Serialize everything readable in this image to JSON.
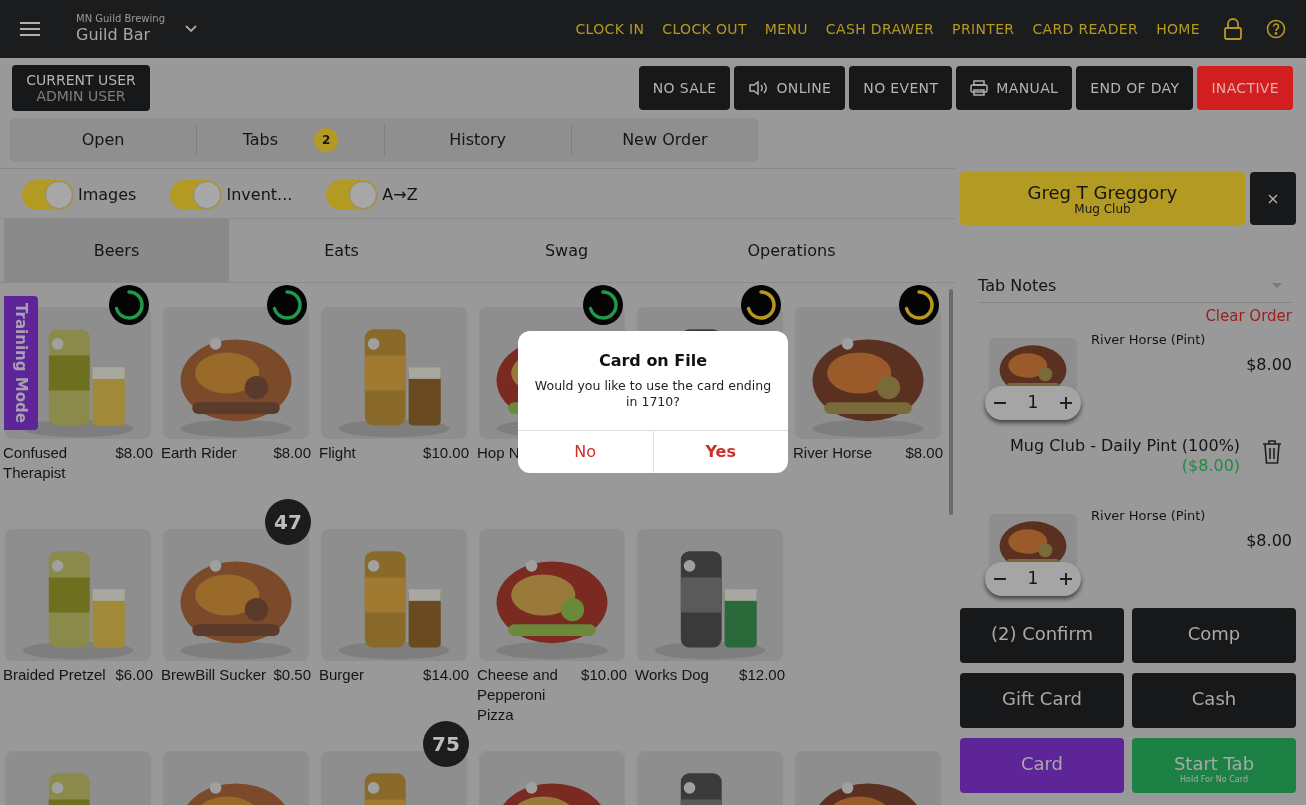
{
  "header": {
    "organization": "MN Guild Brewing",
    "location": "Guild Bar",
    "nav": [
      "CLOCK IN",
      "CLOCK OUT",
      "MENU",
      "CASH DRAWER",
      "PRINTER",
      "CARD READER",
      "HOME"
    ]
  },
  "toolbar": {
    "current_user": {
      "label": "CURRENT USER",
      "value": "ADMIN USER"
    },
    "buttons": [
      {
        "label": "NO SALE",
        "kind": "plain"
      },
      {
        "label": "ONLINE",
        "kind": "speaker"
      },
      {
        "label": "NO EVENT",
        "kind": "plain"
      },
      {
        "label": "MANUAL",
        "kind": "printer"
      },
      {
        "label": "END OF DAY",
        "kind": "plain"
      },
      {
        "label": "INACTIVE",
        "kind": "alert"
      }
    ]
  },
  "order_tabs": [
    {
      "label": "Open",
      "selected": false
    },
    {
      "label": "Tabs",
      "badge": "2",
      "selected": false
    },
    {
      "label": "History",
      "selected": false
    },
    {
      "label": "New Order",
      "selected": false
    }
  ],
  "filters": [
    {
      "label": "Images",
      "on": true
    },
    {
      "label": "Invent...",
      "on": true
    },
    {
      "label": "A→Z",
      "on": true
    }
  ],
  "categories": [
    {
      "label": "Beers",
      "selected": true
    },
    {
      "label": "Eats",
      "selected": false
    },
    {
      "label": "Swag",
      "selected": false
    },
    {
      "label": "Operations",
      "selected": false
    }
  ],
  "training_mode": "Training Mode",
  "product_rows": [
    [
      {
        "kind": "picture",
        "name": "Confused Therapist",
        "price": "$8.00",
        "stock": {
          "color": "#1f9a4a"
        }
      },
      {
        "kind": "picture",
        "name": "Earth Rider",
        "price": "$8.00",
        "stock": {
          "color": "#1f9a4a"
        }
      },
      {
        "kind": "picture",
        "name": "Flight",
        "price": "$10.00"
      },
      {
        "kind": "picture",
        "name": "Hop N",
        "stock": {
          "color": "#1f9a4a"
        }
      },
      {
        "kind": "picture",
        "stock": {
          "color": "#b8981c"
        }
      },
      {
        "kind": "picture",
        "name": "River Horse",
        "price": "$8.00",
        "stock": {
          "color": "#b8981c"
        }
      }
    ],
    [
      {
        "kind": "picture",
        "name": "Braided Pretzel",
        "price": "$6.00"
      },
      {
        "kind": "picture",
        "name": "BrewBill Sucker",
        "price": "$0.50",
        "badge": "47"
      },
      {
        "kind": "picture",
        "name": "Burger",
        "price": "$14.00"
      },
      {
        "kind": "picture",
        "name": "Cheese and Pepperoni Pizza",
        "price": "$10.00"
      },
      {
        "kind": "picture",
        "name": "Works Dog",
        "price": "$12.00"
      }
    ],
    [
      {
        "kind": "picture"
      },
      {
        "kind": "picture"
      },
      {
        "kind": "picture",
        "badge": "75"
      },
      {
        "kind": "picture"
      },
      {
        "kind": "picture"
      },
      {
        "kind": "picture"
      }
    ]
  ],
  "order": {
    "customer": {
      "name": "Greg T Greggory",
      "group": "Mug Club"
    },
    "tab_notes": "Tab Notes",
    "clear_label": "Clear Order",
    "lines": [
      {
        "kind": "item",
        "name": "River Horse (Pint)",
        "price": "$8.00",
        "quantity": "1"
      },
      {
        "kind": "discount",
        "name": "Mug Club - Daily Pint (100%)",
        "amount": "($8.00)"
      },
      {
        "kind": "item",
        "name": "River Horse (Pint)",
        "price": "$8.00",
        "quantity": "1"
      }
    ],
    "actions": [
      {
        "label": "(2) Confirm",
        "kind": "dark"
      },
      {
        "label": "Comp",
        "kind": "dark"
      },
      {
        "label": "Gift Card",
        "kind": "dark"
      },
      {
        "label": "Cash",
        "kind": "dark"
      },
      {
        "label": "Card",
        "kind": "purple"
      },
      {
        "label": "Start Tab",
        "sublabel": "Hold For No Card",
        "kind": "green"
      }
    ]
  },
  "modal": {
    "title": "Card on File",
    "message": "Would you like to use the card ending in 1710?",
    "buttons": [
      {
        "label": "No",
        "default": false
      },
      {
        "label": "Yes",
        "default": true
      }
    ]
  }
}
